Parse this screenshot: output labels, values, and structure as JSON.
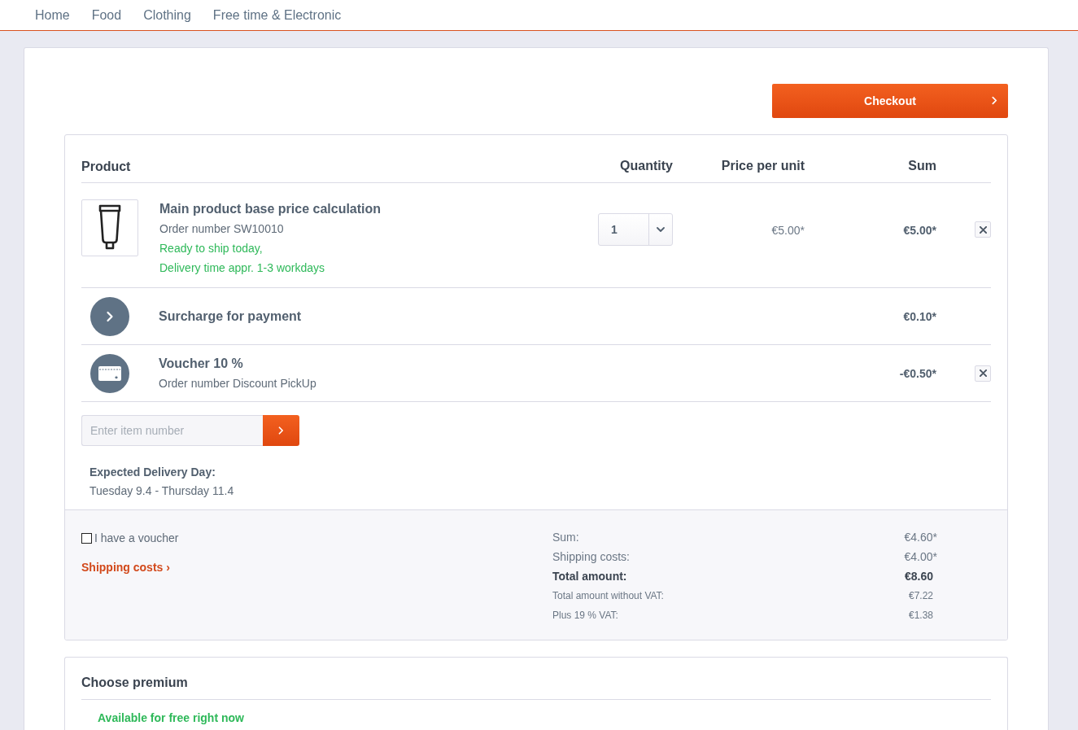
{
  "nav": {
    "items": [
      "Home",
      "Food",
      "Clothing",
      "Free time & Electronic"
    ]
  },
  "checkout_button": {
    "label": "Checkout"
  },
  "cart": {
    "columns": [
      "Product",
      "Quantity",
      "Price per unit",
      "Sum"
    ],
    "items": [
      {
        "kind": "product",
        "title": "Main product base price calculation",
        "subtitle": "Order number SW10010",
        "delivery": [
          "Ready to ship today,",
          "Delivery time appr. 1-3 workdays"
        ],
        "quantity": "1",
        "unit_price": "€5.00*",
        "sum": "€5.00*",
        "removable": true
      },
      {
        "kind": "surcharge",
        "title": "Surcharge for payment",
        "sum": "€0.10*"
      },
      {
        "kind": "voucher",
        "title": "Voucher 10 %",
        "subtitle": "Order number Discount PickUp",
        "sum": "-€0.50*",
        "removable": true
      }
    ],
    "add_item": {
      "placeholder": "Enter item number"
    },
    "delivery": {
      "label": "Expected Delivery Day:",
      "dates": "Tuesday 9.4 - Thursday 11.4"
    }
  },
  "footer": {
    "voucher_checkbox": {
      "label": "I have a voucher",
      "checked": false
    },
    "shipping_link": "Shipping costs ›",
    "summary": [
      {
        "kind": "regular",
        "label": "Sum:",
        "value": "€4.60*"
      },
      {
        "kind": "regular",
        "label": "Shipping costs:",
        "value": "€4.00*"
      },
      {
        "kind": "total",
        "label": "Total amount:",
        "value": "€8.60"
      },
      {
        "kind": "small",
        "label": "Total amount without VAT:",
        "value": "€7.22"
      },
      {
        "kind": "small",
        "label": "Plus 19 % VAT:",
        "value": "€1.38"
      }
    ]
  },
  "premium": {
    "title": "Choose premium",
    "availability": "Available for free right now"
  }
}
